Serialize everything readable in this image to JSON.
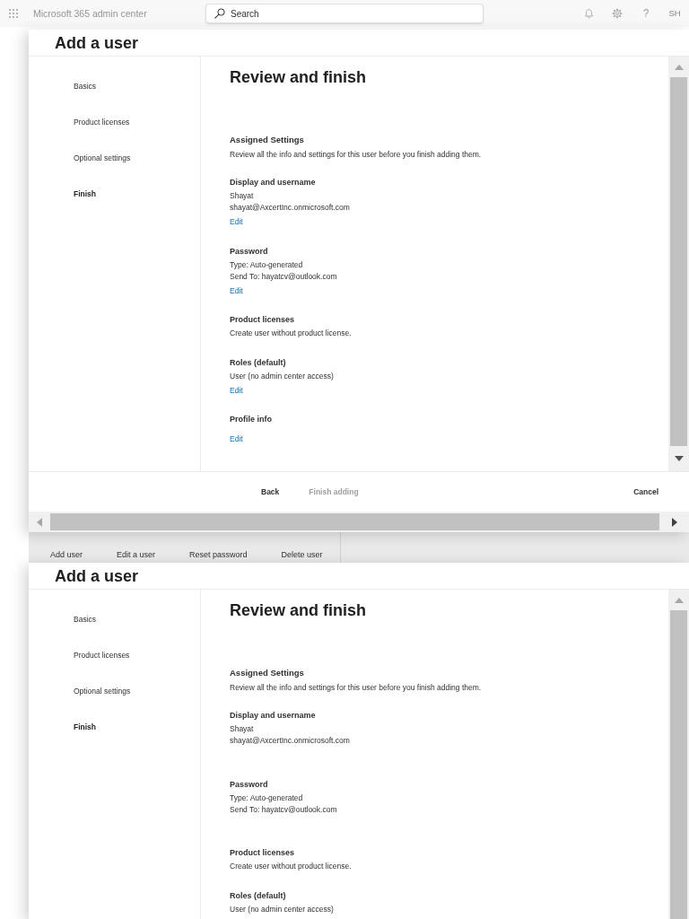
{
  "top_bar": {
    "app_title": "Microsoft 365 admin center",
    "search": {
      "placeholder": "Search"
    },
    "help_label": "?",
    "avatar_initials": "SH"
  },
  "layers": [
    {
      "kind": "dialog",
      "title": "Add a user",
      "steps": [
        {
          "label": "Basics",
          "selected": false
        },
        {
          "label": "Product licenses",
          "selected": false
        },
        {
          "label": "Optional settings",
          "selected": false
        },
        {
          "label": "Finish",
          "selected": true
        }
      ],
      "heading": "Review and finish",
      "intro": {
        "title": "Assigned Settings",
        "text": "Review all the info and settings for this user before you finish adding them."
      },
      "sections": [
        {
          "title": "Display and username",
          "lines": [
            "Shayat",
            "shayat@AxcertInc.onmicrosoft.com"
          ],
          "edit": "Edit"
        },
        {
          "title": "Password",
          "lines": [
            "Type: Auto-generated",
            "Send To: hayatcv@outlook.com"
          ],
          "edit": "Edit"
        },
        {
          "title": "Product licenses",
          "lines": [
            "Create user without product license."
          ]
        },
        {
          "title": "Roles (default)",
          "lines": [
            "User (no admin center access)"
          ],
          "edit": "Edit"
        },
        {
          "title": "Profile info",
          "edit": "Edit"
        }
      ],
      "footer": {
        "buttons": [
          {
            "label": "Back",
            "disabled": false
          },
          {
            "label": "Finish adding",
            "disabled": true
          },
          {
            "label": "Cancel",
            "disabled": false
          }
        ]
      }
    },
    {
      "kind": "toolbar",
      "buttons": [
        "Add user",
        "Edit a user",
        "Reset password",
        "Delete user"
      ]
    },
    {
      "kind": "dialog",
      "title": "Add a user",
      "steps": [
        {
          "label": "Basics",
          "selected": false
        },
        {
          "label": "Product licenses",
          "selected": false
        },
        {
          "label": "Optional settings",
          "selected": false
        },
        {
          "label": "Finish",
          "selected": true
        }
      ],
      "heading": "Review and finish",
      "intro": {
        "title": "Assigned Settings",
        "text": "Review all the info and settings for this user before you finish adding them."
      },
      "sections": [
        {
          "title": "Display and username",
          "lines": [
            "Shayat",
            "shayat@AxcertInc.onmicrosoft.com"
          ],
          "edit_hidden": true
        },
        {
          "title": "Password",
          "lines": [
            "Type: Auto-generated",
            "Send To: hayatcv@outlook.com"
          ],
          "edit_hidden": true
        },
        {
          "title": "Product licenses",
          "lines": [
            "Create user without product license."
          ]
        },
        {
          "title": "Roles (default)",
          "lines": [
            "User (no admin center access)"
          ]
        }
      ]
    }
  ]
}
